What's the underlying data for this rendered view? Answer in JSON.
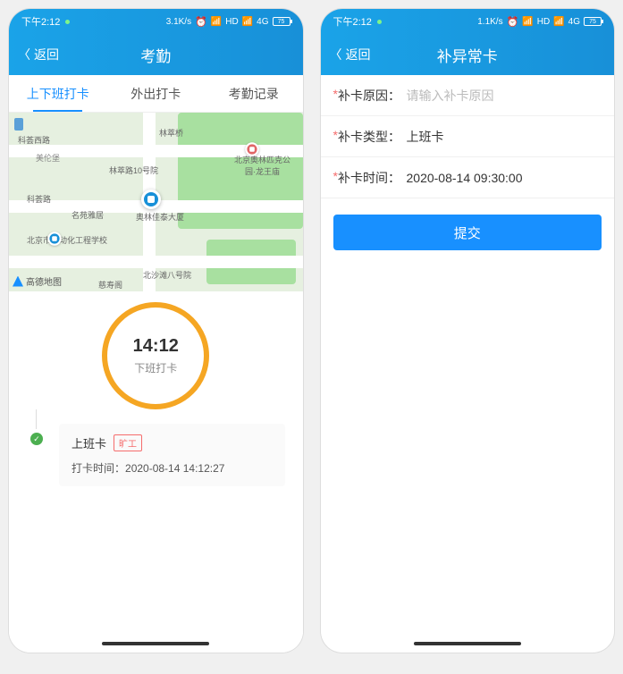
{
  "status": {
    "time": "下午2:12",
    "net_speed": "3.1K/s",
    "net_speed_r": "1.1K/s",
    "hd": "HD",
    "sig": "4G",
    "battery": "75"
  },
  "left": {
    "back": "返回",
    "title": "考勤",
    "tabs": [
      "上下班打卡",
      "外出打卡",
      "考勤记录"
    ],
    "map_labels": {
      "a": "科荟西路",
      "b": "美伦堡",
      "c": "科荟路",
      "d": "名苑雅居",
      "e": "北京市自动化工程学校",
      "f": "林萃桥",
      "g": "林萃路10号院",
      "h": "奥林佳泰大厦",
      "i": "北沙滩八号院",
      "j": "慈寿阁",
      "k": "北京奥林匹克公园·龙王庙",
      "attr": "高德地图"
    },
    "clock": {
      "time": "14:12",
      "label": "下班打卡"
    },
    "record": {
      "title": "上班卡",
      "badge": "旷工",
      "time_label": "打卡时间：",
      "time_value": "2020-08-14 14:12:27"
    }
  },
  "right": {
    "back": "返回",
    "title": "补异常卡",
    "rows": {
      "reason_label": "补卡原因：",
      "reason_placeholder": "请输入补卡原因",
      "type_label": "补卡类型：",
      "type_value": "上班卡",
      "time_label": "补卡时间：",
      "time_value": "2020-08-14 09:30:00"
    },
    "submit": "提交"
  }
}
